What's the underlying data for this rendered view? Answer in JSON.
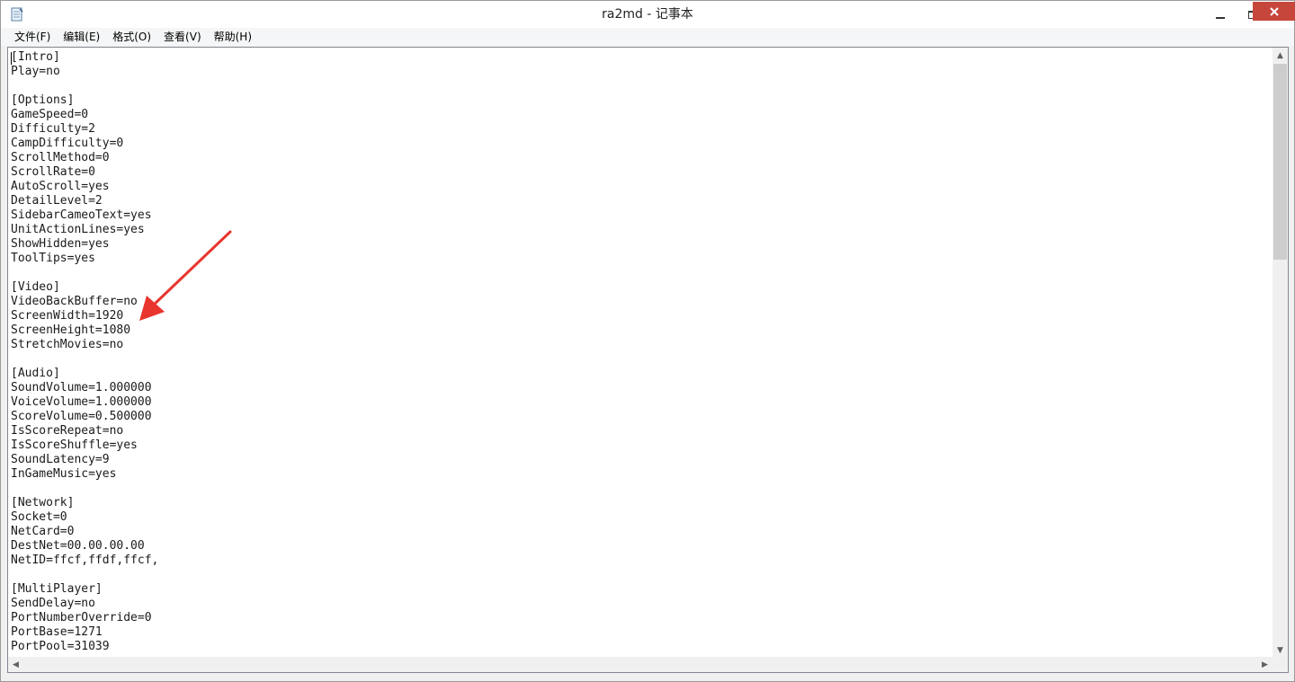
{
  "window": {
    "title": "ra2md - 记事本",
    "icon": "notepad-icon"
  },
  "menu": [
    "文件(F)",
    "编辑(E)",
    "格式(O)",
    "查看(V)",
    "帮助(H)"
  ],
  "content": {
    "lines": [
      "[Intro]",
      "Play=no",
      "",
      "[Options]",
      "GameSpeed=0",
      "Difficulty=2",
      "CampDifficulty=0",
      "ScrollMethod=0",
      "ScrollRate=0",
      "AutoScroll=yes",
      "DetailLevel=2",
      "SidebarCameoText=yes",
      "UnitActionLines=yes",
      "ShowHidden=yes",
      "ToolTips=yes",
      "",
      "[Video]",
      "VideoBackBuffer=no",
      "ScreenWidth=1920",
      "ScreenHeight=1080",
      "StretchMovies=no",
      "",
      "[Audio]",
      "SoundVolume=1.000000",
      "VoiceVolume=1.000000",
      "ScoreVolume=0.500000",
      "IsScoreRepeat=no",
      "IsScoreShuffle=yes",
      "SoundLatency=9",
      "InGameMusic=yes",
      "",
      "[Network]",
      "Socket=0",
      "NetCard=0",
      "DestNet=00.00.00.00",
      "NetID=ffcf,ffdf,ffcf,",
      "",
      "[MultiPlayer]",
      "SendDelay=no",
      "PortNumberOverride=0",
      "PortBase=1271",
      "PortPool=31039"
    ]
  },
  "colors": {
    "annotation_arrow": "#e8352d",
    "close_button": "#c7463c"
  },
  "icons": {
    "minimize": "minimize-icon",
    "maximize": "maximize-icon",
    "close": "close-icon"
  }
}
